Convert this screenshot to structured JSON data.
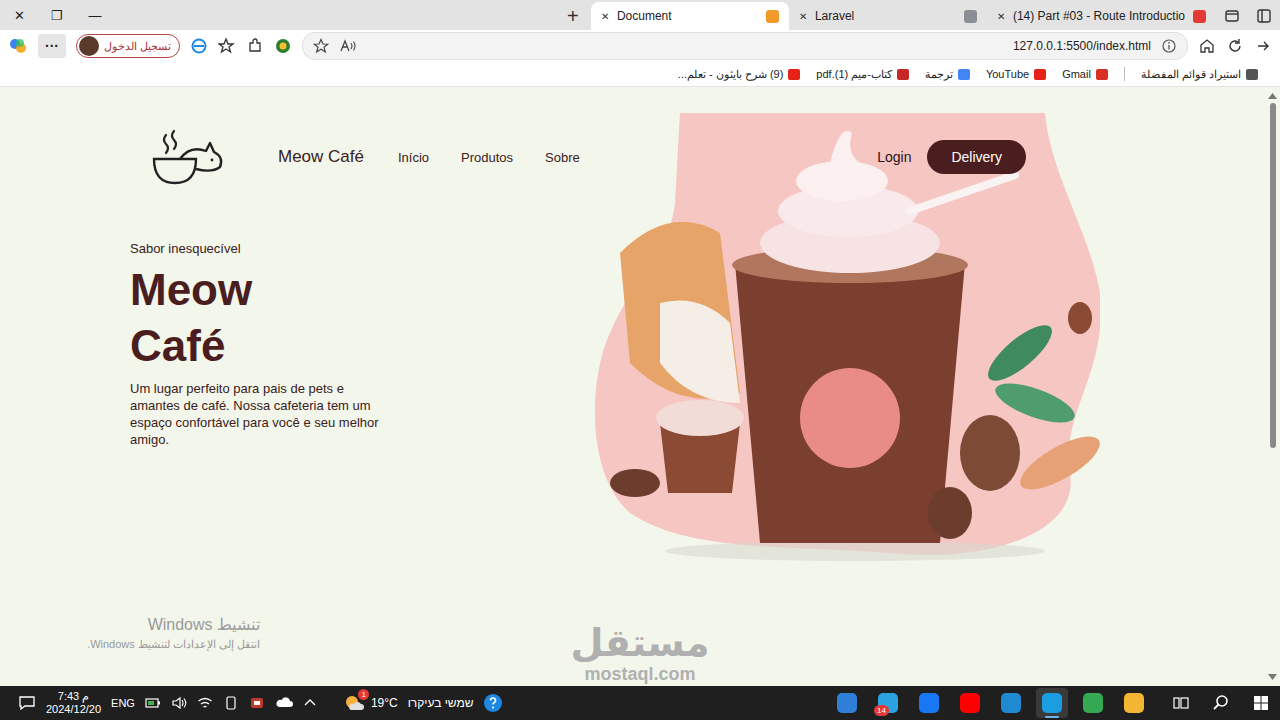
{
  "window": {
    "controls": [
      "✕",
      "❐",
      "—"
    ]
  },
  "new_tab": "+",
  "tabs": [
    {
      "label": "Document",
      "selected": true,
      "close": "✕",
      "color": "#f39a2b"
    },
    {
      "label": "Laravel",
      "selected": false,
      "close": "✕",
      "color": "#8a8f96"
    },
    {
      "label": "(14) Part #03 - Route Introductio",
      "selected": false,
      "close": "✕",
      "color": "#e53935"
    }
  ],
  "toolbar": {
    "more": "···",
    "profile": "تسجيل الدخول"
  },
  "address": {
    "url": "127.0.0.1:5500/index.html"
  },
  "bookmarks": [
    {
      "label": "استيراد قوائم المفضلة",
      "color": "#555555"
    },
    {
      "label": "Gmail",
      "color": "#d93025"
    },
    {
      "label": "YouTube",
      "color": "#e62117"
    },
    {
      "label": "ترجمة",
      "color": "#4285f4"
    },
    {
      "label": "كتاب-ميم (1).pdf",
      "color": "#c62828"
    },
    {
      "label": "(9) شرح بايثون - تعلم...",
      "color": "#e62117"
    }
  ],
  "page": {
    "nav": {
      "brand": "Meow Café",
      "links": [
        "Início",
        "Produtos",
        "Sobre"
      ],
      "login": "Login",
      "delivery": "Delivery"
    },
    "hero": {
      "kicker": "Sabor inesquecível",
      "title": [
        "Meow",
        "Café"
      ],
      "text": "Um lugar perfeito para pais de pets e amantes de café. Nossa cafeteria tem um espaço confortável para você e seu melhor amigo."
    }
  },
  "activation": {
    "title": "تنشيط Windows",
    "subtitle": "انتقل إلى الإعدادات لتنشيط Windows."
  },
  "watermark": {
    "arabic": "مستقل",
    "latin": "mostaql.com"
  },
  "taskbar": {
    "time": "7:43 م",
    "date": "2024/12/20",
    "lang": "ENG",
    "weather": {
      "temp": "19°C",
      "text": "שמשי בעיקרו",
      "badge": "1"
    },
    "apps": [
      {
        "color": "#2f7fd8",
        "selected": false
      },
      {
        "color": "#2aa3e0",
        "selected": false,
        "badge": "14"
      },
      {
        "color": "#1877f2",
        "selected": false
      },
      {
        "color": "#ff0000",
        "selected": false
      },
      {
        "color": "#1f8ad2",
        "selected": false
      },
      {
        "color": "#1b9de2",
        "selected": true
      },
      {
        "color": "#34a853",
        "selected": false
      },
      {
        "color": "#f2b632",
        "selected": false
      }
    ]
  }
}
